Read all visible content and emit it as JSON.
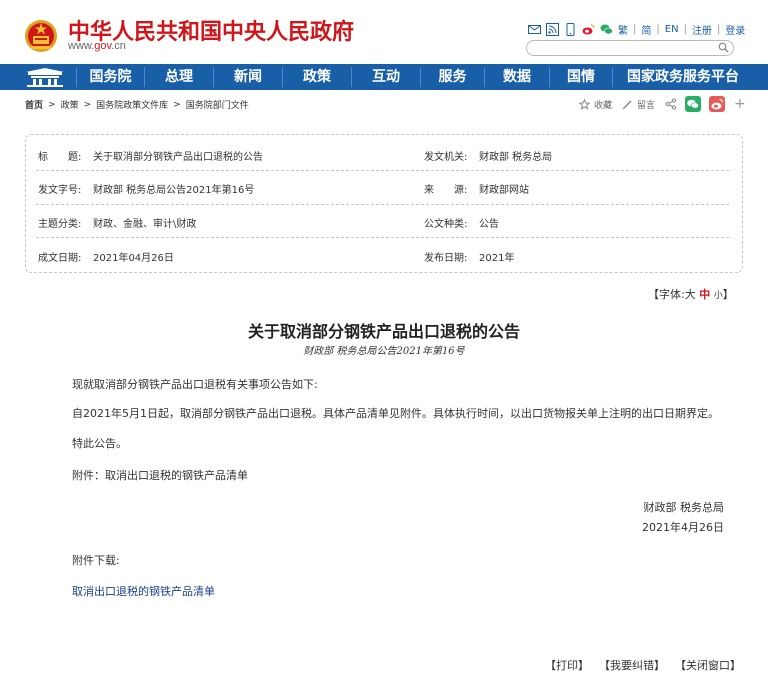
{
  "header": {
    "site_title": "中华人民共和国中央人民政府",
    "url_prefix": "www.",
    "url_domain": "gov",
    "url_suffix": ".cn",
    "links": {
      "trad": "繁",
      "simp": "简",
      "en": "EN",
      "register": "注册",
      "login": "登录"
    },
    "search_placeholder": ""
  },
  "nav": {
    "items": [
      "国务院",
      "总理",
      "新闻",
      "政策",
      "互动",
      "服务",
      "数据",
      "国情",
      "国家政务服务平台"
    ]
  },
  "breadcrumb": {
    "items": [
      "首页",
      "政策",
      "国务院政策文件库",
      "国务院部门文件"
    ],
    "sep": ">"
  },
  "share": {
    "favorite": "收藏",
    "comment": "留言"
  },
  "info": {
    "title_label": "标　　题:",
    "title_value": "关于取消部分钢铁产品出口退税的公告",
    "issuer_label": "发文机关:",
    "issuer_value": "财政部 税务总局",
    "docno_label": "发文字号:",
    "docno_value": "财政部 税务总局公告2021年第16号",
    "source_label": "来　　源:",
    "source_value": "财政部网站",
    "topic_label": "主题分类:",
    "topic_value": "财政、金融、审计\\财政",
    "type_label": "公文种类:",
    "type_value": "公告",
    "written_label": "成文日期:",
    "written_value": "2021年04月26日",
    "published_label": "发布日期:",
    "published_value": "2021年"
  },
  "fontsize": {
    "prefix": "【字体:",
    "large": "大",
    "medium": "中",
    "small": "小",
    "suffix": "】"
  },
  "article": {
    "title": "关于取消部分钢铁产品出口退税的公告",
    "subtitle": "财政部 税务总局公告2021年第16号",
    "p1": "现就取消部分钢铁产品出口退税有关事项公告如下:",
    "p2": "自2021年5月1日起，取消部分钢铁产品出口退税。具体产品清单见附件。具体执行时间，以出口货物报关单上注明的出口日期界定。",
    "p3": "特此公告。",
    "p4": "附件：取消出口退税的钢铁产品清单",
    "sign_org": "财政部 税务总局",
    "sign_date": "2021年4月26日",
    "attachment_label": "附件下载:",
    "attachment_link": "取消出口退税的钢铁产品清单"
  },
  "footer": {
    "print": "【打印】",
    "report_error": "【我要纠错】",
    "close": "【关闭窗口】"
  },
  "colors": {
    "brand_red": "#d0161b",
    "nav_blue": "#185fa8",
    "link_blue": "#1a3f91"
  }
}
